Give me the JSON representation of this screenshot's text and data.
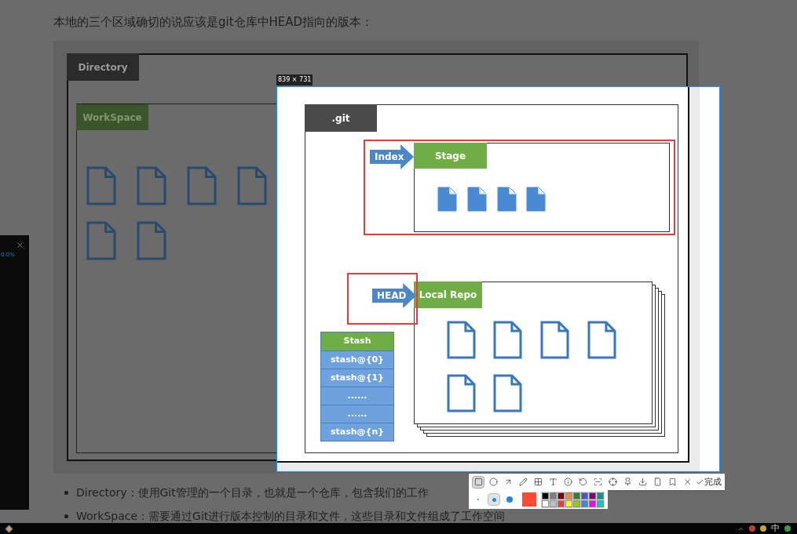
{
  "heading": "本地的三个区域确切的说应该是git仓库中HEAD指向的版本：",
  "diagram": {
    "directory": "Directory",
    "workspace": "WorkSpace",
    "git": ".git",
    "index": "Index",
    "stage": "Stage",
    "head": "HEAD",
    "local_repo": "Local Repo",
    "stash": {
      "title": "Stash",
      "rows": [
        "stash@{0}",
        "stash@{1}",
        "......",
        "......",
        "stash@{n}"
      ]
    }
  },
  "selection": {
    "size": "839 × 731"
  },
  "toolbar": {
    "tools": [
      {
        "kind": "rectangle",
        "selected": true
      },
      {
        "kind": "ellipse",
        "selected": false
      },
      {
        "kind": "arrow",
        "selected": false
      },
      {
        "kind": "pen",
        "selected": false
      },
      {
        "kind": "mosaic",
        "selected": false
      },
      {
        "kind": "text",
        "selected": false
      },
      {
        "kind": "number",
        "selected": false
      },
      {
        "kind": "undo",
        "selected": false
      },
      {
        "kind": "scan",
        "selected": false
      },
      {
        "kind": "crosshair",
        "selected": false
      },
      {
        "kind": "pin",
        "selected": false
      },
      {
        "kind": "download",
        "selected": false
      },
      {
        "kind": "phone",
        "selected": false
      },
      {
        "kind": "bookmark",
        "selected": false
      },
      {
        "kind": "close",
        "selected": false
      }
    ],
    "done": "完成",
    "sizes": [
      {
        "selected": false
      },
      {
        "selected": true
      },
      {
        "selected": false
      }
    ],
    "current": {
      "color": "#ff4b33"
    },
    "palette": [
      {
        "color": "#000000"
      },
      {
        "color": "#808080"
      },
      {
        "color": "#800000"
      },
      {
        "color": "#f7883a"
      },
      {
        "color": "#308430"
      },
      {
        "color": "#385ad3"
      },
      {
        "color": "#800080"
      },
      {
        "color": "#009999"
      },
      {
        "color": "#ffffff"
      },
      {
        "color": "#c0c0c0"
      },
      {
        "color": "#fb3838"
      },
      {
        "color": "#ffff00"
      },
      {
        "color": "#99cc00"
      },
      {
        "color": "#3d85e6"
      },
      {
        "color": "#ff00ff"
      },
      {
        "color": "#00cccc"
      }
    ]
  },
  "side_panel": {
    "reading": "0.0%"
  },
  "bullets": [
    "Directory：使用Git管理的一个目录，也就是一个仓库，包含我们的工作",
    "WorkSpace：需要通过Git进行版本控制的目录和文件，这些目录和文件组成了工作空间"
  ],
  "taskbar": {
    "ime": "中"
  }
}
